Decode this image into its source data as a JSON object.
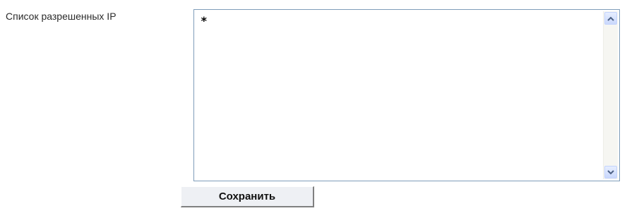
{
  "form": {
    "field_label": "Список разрешенных IP",
    "textarea_value": "*",
    "save_label": "Сохранить"
  },
  "icons": {
    "scroll_up": "chevron-up-icon",
    "scroll_down": "chevron-down-icon"
  },
  "colors": {
    "input_border": "#7f9db9",
    "scroll_button": "#cad8fc",
    "button_face": "#eef0f4"
  }
}
